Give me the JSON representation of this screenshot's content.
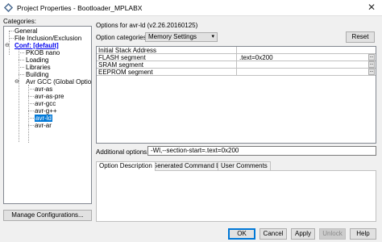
{
  "window": {
    "title": "Project Properties - Bootloader_MPLABX",
    "close_glyph": "✕"
  },
  "categories": {
    "label": "Categories:",
    "items": [
      {
        "label": "General"
      },
      {
        "label": "File Inclusion/Exclusion"
      },
      {
        "label": "Conf: [default]"
      },
      {
        "label": "PKOB nano"
      },
      {
        "label": "Loading"
      },
      {
        "label": "Libraries"
      },
      {
        "label": "Building"
      },
      {
        "label": "Avr GCC (Global Options)"
      },
      {
        "label": "avr-as"
      },
      {
        "label": "avr-as-pre"
      },
      {
        "label": "avr-gcc"
      },
      {
        "label": "avr-g++"
      },
      {
        "label": "avr-ld"
      },
      {
        "label": "avr-ar"
      }
    ],
    "manage_button": "Manage Configurations..."
  },
  "options": {
    "title": "Options for avr-ld (v2.26.20160125)",
    "category_label": "Option categories:",
    "category_value": "Memory Settings",
    "reset_button": "Reset",
    "rows": [
      {
        "key": "Initial Stack Address",
        "value": ""
      },
      {
        "key": "FLASH segment",
        "value": ".text=0x200"
      },
      {
        "key": "SRAM segment",
        "value": ""
      },
      {
        "key": "EEPROM segment",
        "value": ""
      }
    ],
    "dots_glyph": "...",
    "additional_label": "Additional options:",
    "additional_value": "-Wl,--section-start=.text=0x200"
  },
  "tabs": [
    {
      "label": "Option Description"
    },
    {
      "label": "Generated Command Line"
    },
    {
      "label": "User Comments"
    }
  ],
  "footer": {
    "ok": "OK",
    "cancel": "Cancel",
    "apply": "Apply",
    "unlock": "Unlock",
    "help": "Help"
  }
}
